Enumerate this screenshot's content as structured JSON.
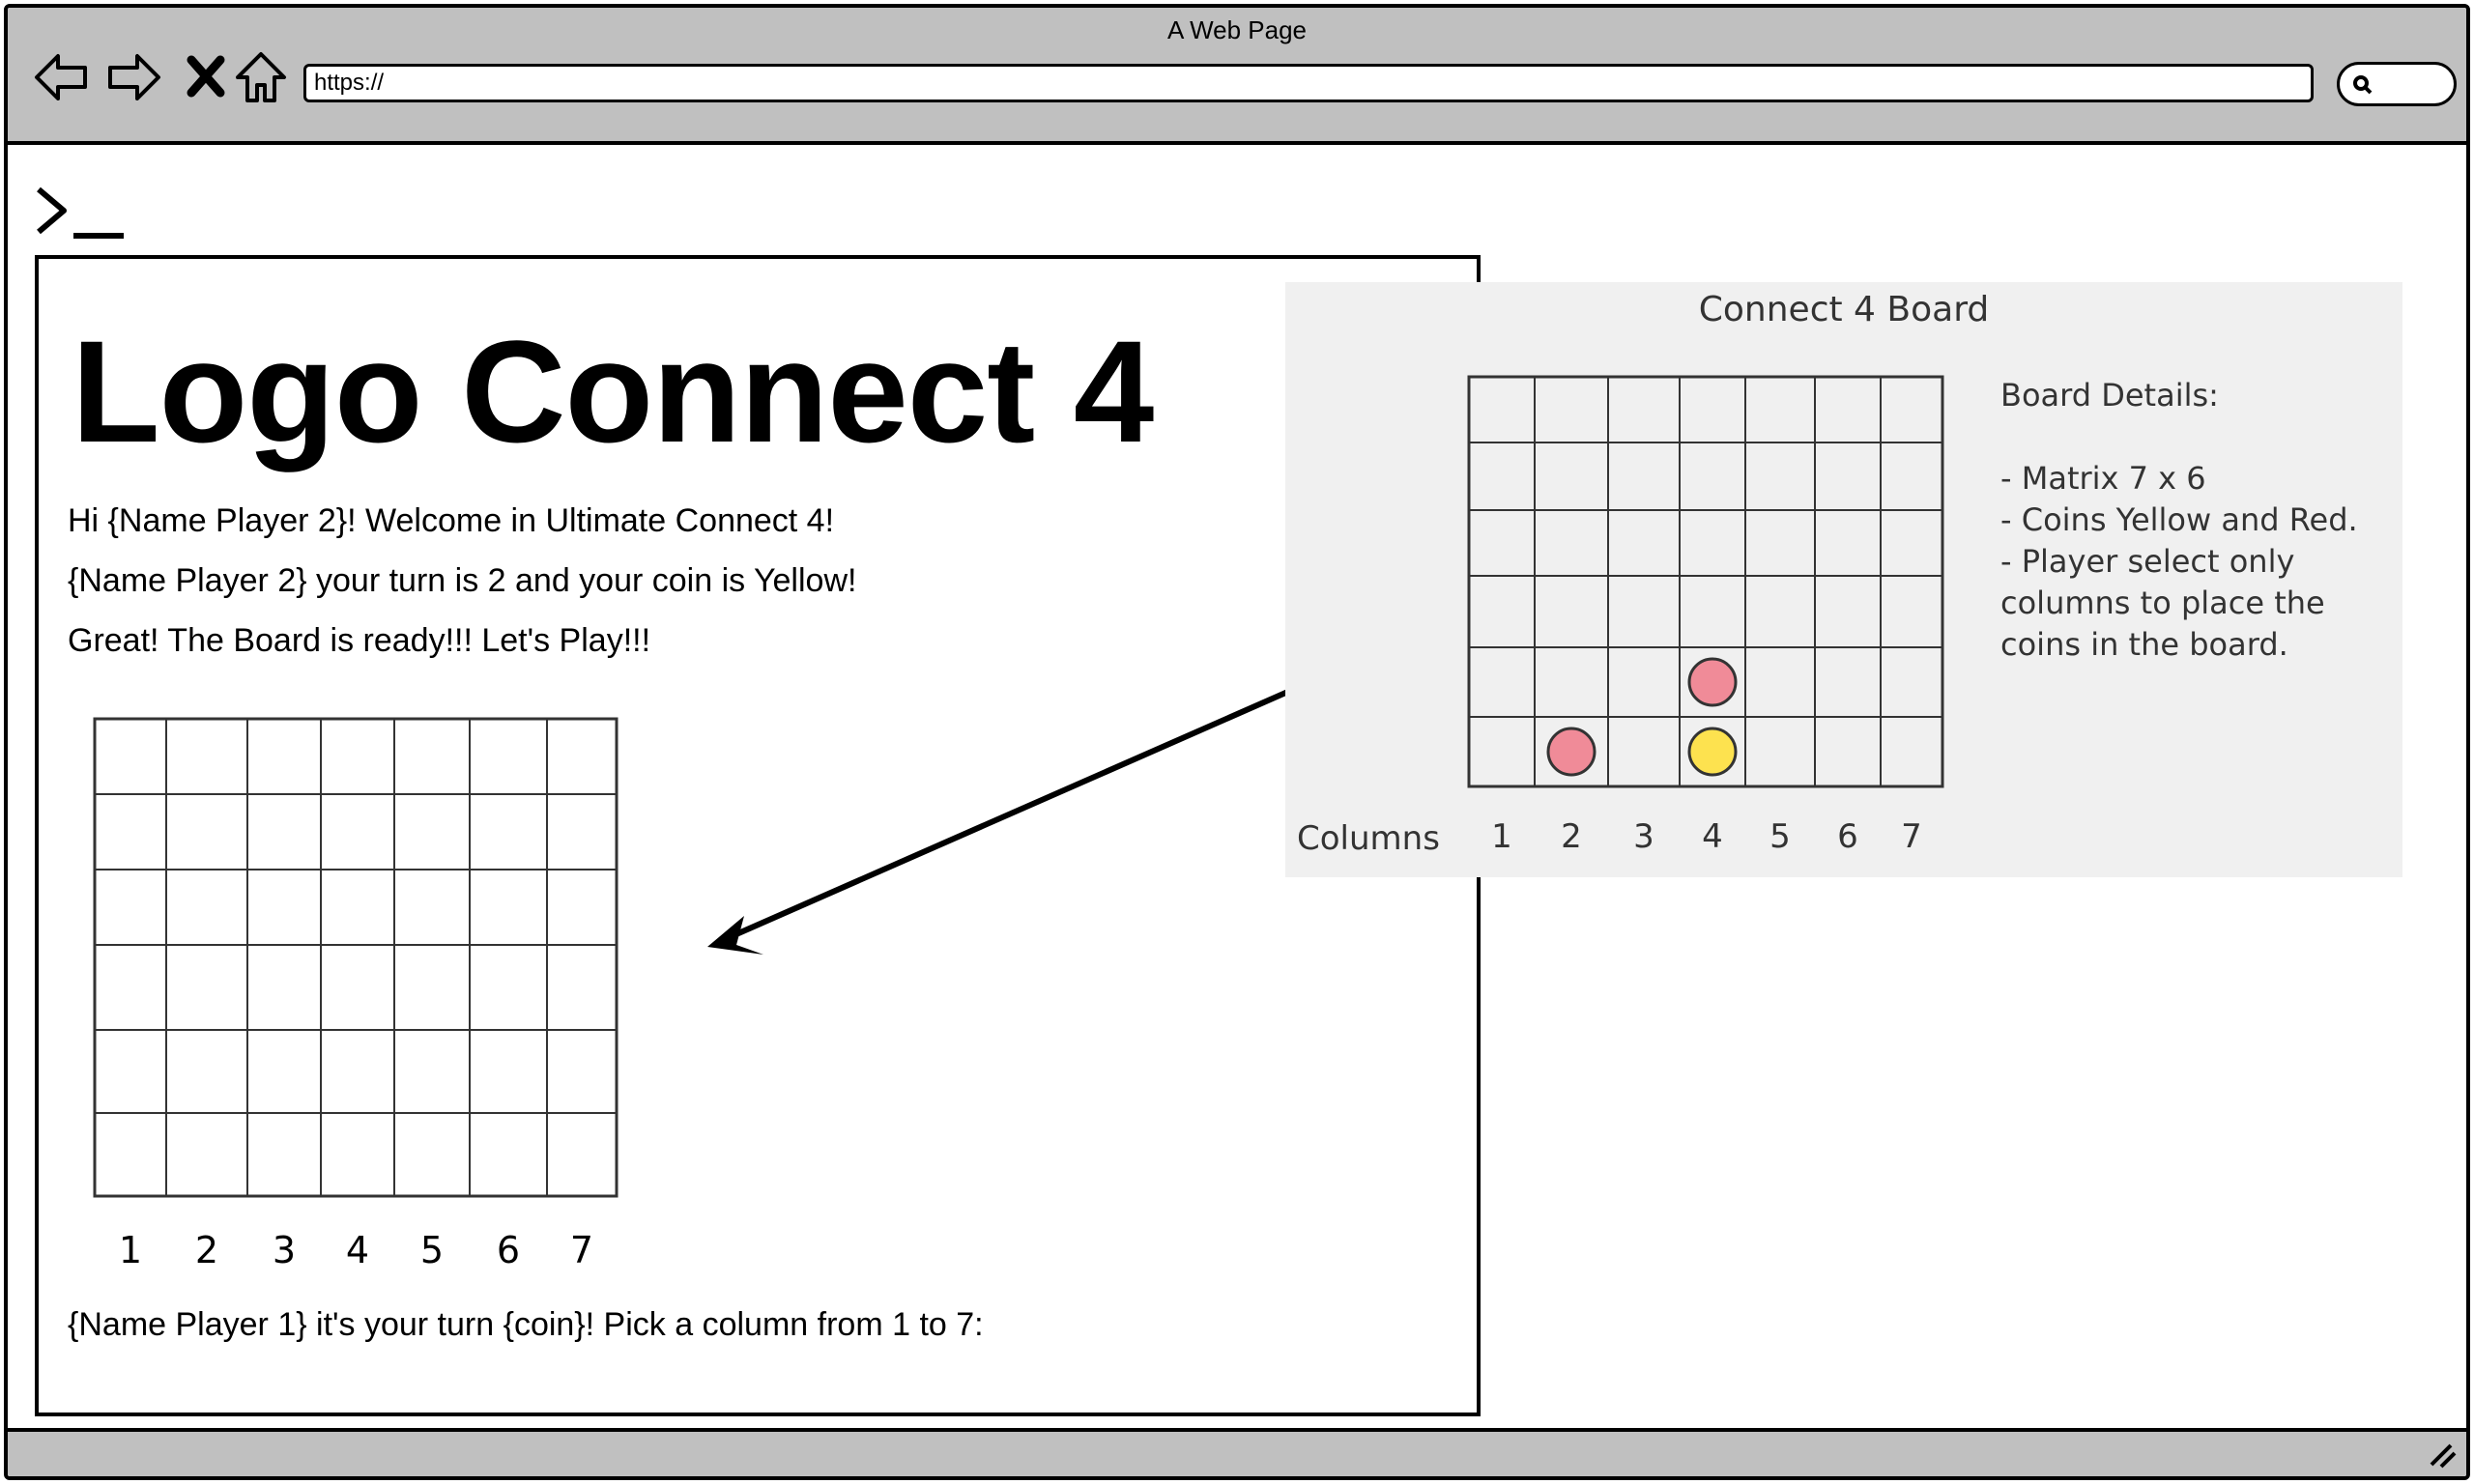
{
  "window": {
    "title": "A Web Page"
  },
  "toolbar": {
    "url": "https://"
  },
  "console": {
    "heading": "Logo Connect 4",
    "messages": [
      "Hi {Name Player 2}! Welcome in Ultimate Connect 4!",
      "{Name Player 2} your turn is 2 and your coin is Yellow!",
      "Great! The Board is ready!!! Let's Play!!!"
    ],
    "board": {
      "columns": 7,
      "rows": 6
    },
    "column_labels": [
      "1",
      "2",
      "3",
      "4",
      "5",
      "6",
      "7"
    ],
    "prompt": "{Name Player 1} it's your turn {coin}! Pick a column from 1 to 7:"
  },
  "panel": {
    "title": "Connect 4 Board",
    "details_title": "Board Details:",
    "details": [
      "- Matrix 7 x 6",
      "- Coins Yellow and Red.",
      "- Player select only columns to place the coins in the board."
    ],
    "columns_label": "Columns",
    "column_labels": [
      "1",
      "2",
      "3",
      "4",
      "5",
      "6",
      "7"
    ],
    "coins": [
      {
        "column": 4,
        "row_from_bottom": 2,
        "color": "red"
      },
      {
        "column": 2,
        "row_from_bottom": 1,
        "color": "red"
      },
      {
        "column": 4,
        "row_from_bottom": 1,
        "color": "yellow"
      }
    ],
    "coin_colors": {
      "red": "#f08b98",
      "yellow": "#fde24f"
    }
  },
  "icons": [
    "back-icon",
    "forward-icon",
    "close-icon",
    "home-icon",
    "search-icon",
    "terminal-icon",
    "resize-grip-icon"
  ]
}
